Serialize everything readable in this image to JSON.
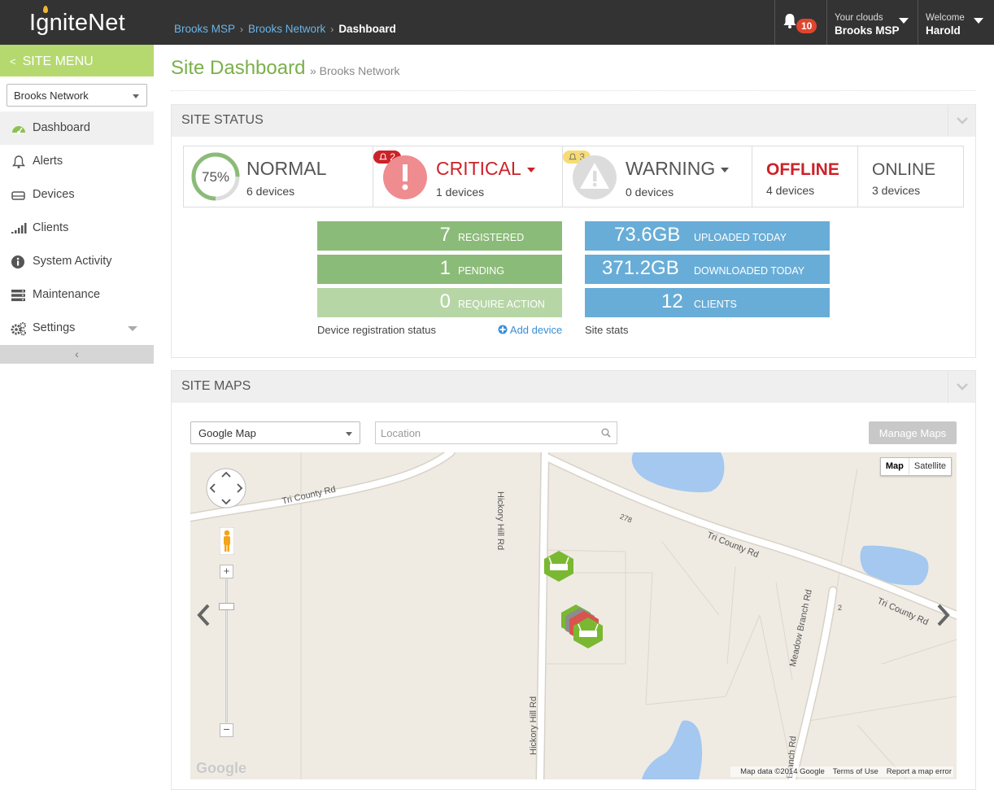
{
  "header": {
    "logo": "IgniteNet",
    "breadcrumb": [
      "Brooks MSP",
      "Brooks Network",
      "Dashboard"
    ],
    "notifications_count": "10",
    "clouds_label": "Your clouds",
    "clouds_value": "Brooks MSP",
    "welcome_label": "Welcome",
    "welcome_user": "Harold"
  },
  "sidebar": {
    "menu_title": "SITE MENU",
    "network_select": "Brooks Network",
    "items": [
      {
        "label": "Dashboard",
        "icon": "gauge-icon"
      },
      {
        "label": "Alerts",
        "icon": "bell-icon"
      },
      {
        "label": "Devices",
        "icon": "devices-icon"
      },
      {
        "label": "Clients",
        "icon": "signal-icon"
      },
      {
        "label": "System Activity",
        "icon": "info-icon"
      },
      {
        "label": "Maintenance",
        "icon": "maintenance-icon"
      },
      {
        "label": "Settings",
        "icon": "gears-icon"
      }
    ],
    "collapse": "‹"
  },
  "page": {
    "title": "Site Dashboard",
    "subtitle": "» Brooks Network"
  },
  "site_status": {
    "header": "SITE STATUS",
    "normal": {
      "percent": 75,
      "percent_label": "75%",
      "label": "NORMAL",
      "count": "6 devices"
    },
    "critical": {
      "badge": "2",
      "label": "CRITICAL",
      "count": "1 devices"
    },
    "warning": {
      "badge": "3",
      "label": "WARNING",
      "count": "0 devices"
    },
    "offline": {
      "label": "OFFLINE",
      "count": "4 devices"
    },
    "online": {
      "label": "ONLINE",
      "count": "3 devices"
    },
    "registration": [
      {
        "value": "7",
        "label": "REGISTERED"
      },
      {
        "value": "1",
        "label": "PENDING"
      },
      {
        "value": "0",
        "label": "REQUIRE ACTION"
      }
    ],
    "registration_caption": "Device registration status",
    "add_device": "Add device",
    "stats": [
      {
        "value": "73.6GB",
        "label": "UPLOADED TODAY"
      },
      {
        "value": "371.2GB",
        "label": "DOWNLOADED TODAY"
      },
      {
        "value": "12",
        "label": "CLIENTS"
      }
    ],
    "stats_caption": "Site stats"
  },
  "site_maps": {
    "header": "SITE MAPS",
    "map_type": "Google Map",
    "location_placeholder": "Location",
    "manage_button": "Manage Maps",
    "toggle_map": "Map",
    "toggle_satellite": "Satellite",
    "roads": [
      "Tri County Rd",
      "Hickory Hill Rd",
      "Tri County Rd",
      "Tri County Rd",
      "Meadow Branch Rd",
      "Hickory Hill Rd",
      "278",
      "2",
      "Branch Rd"
    ],
    "google": "Google",
    "map_data": "Map data ©2014 Google",
    "terms": "Terms of Use",
    "report": "Report a map error",
    "colors": {
      "water": "#a4c8f0",
      "road": "#ffffff",
      "device_green": "#7ab832",
      "device_red": "#d9534f",
      "device_gray": "#8c8c8c"
    }
  }
}
